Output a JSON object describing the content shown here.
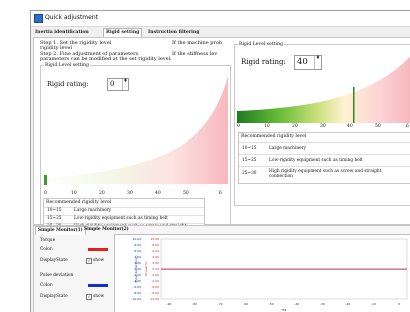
{
  "window": {
    "title": "Quick adjustment"
  },
  "tabs": [
    "Inertia identification",
    "Rigid setting",
    "Instruction filtering"
  ],
  "steps": {
    "step1": "Step 1. Set the rigidity level",
    "step1_wrap": "rigidity level",
    "step1_right": "If the machine prob",
    "step2": "Step 2. Fine adjustment of parameters",
    "step2_wrap": "parameters can be modified at the set rigidity level.",
    "step2_right": "If the stiffness lev"
  },
  "left_group": {
    "title": "Rigid Level setting",
    "rating_label": "Rigid rating:",
    "rating_value": "0",
    "ticks": [
      "0",
      "10",
      "20",
      "30",
      "40",
      "50",
      "6"
    ]
  },
  "right_group": {
    "title": "Rigid Level setting",
    "rating_label": "Rigid rating:",
    "rating_value": "40",
    "ticks": [
      "0",
      "10",
      "20",
      "30",
      "40",
      "50",
      "6"
    ]
  },
  "recommend": {
    "title": "Recommended rigidity level",
    "rows": [
      {
        "range": "10~15",
        "desc": "Large machinery"
      },
      {
        "range": "15~25",
        "desc": "Low-rigidity equipment such as timing belt"
      },
      {
        "range": "25~30",
        "desc": "High rigidity equipment such as screw and straight",
        "desc2": "connection"
      }
    ]
  },
  "bottom": {
    "tabs": [
      "Simple Monitor(1)",
      "Simple Monitor(2)"
    ],
    "torque_title": "Torque",
    "color_label": "Color:",
    "display_label": "DisplayState",
    "show": "show",
    "pulse_title": "Pulse deviation",
    "torque_color": "#e02020",
    "pulse_color": "#1030d0",
    "y_labels_left": [
      "10.00",
      "8.00",
      "6.00",
      "4.00",
      "2.00",
      "0.00",
      "-2.00",
      "-4.00",
      "-6.00",
      "-8.00",
      "-10.00"
    ],
    "y_labels_right": [
      "10.00",
      "8.00",
      "6.00",
      "4.00",
      "2.00",
      "0.00",
      "-2.00",
      "-4.00",
      "-6.00",
      "-8.00",
      "-10.00"
    ],
    "x_labels": [
      "-90",
      "-80",
      "-70",
      "-60",
      "-50",
      "-40",
      "-30",
      "-20",
      "-10",
      "0"
    ],
    "axis_left_title": "Pulse deviation(p)",
    "axis_right_title": "Torque(%)",
    "x_title": "ms"
  }
}
